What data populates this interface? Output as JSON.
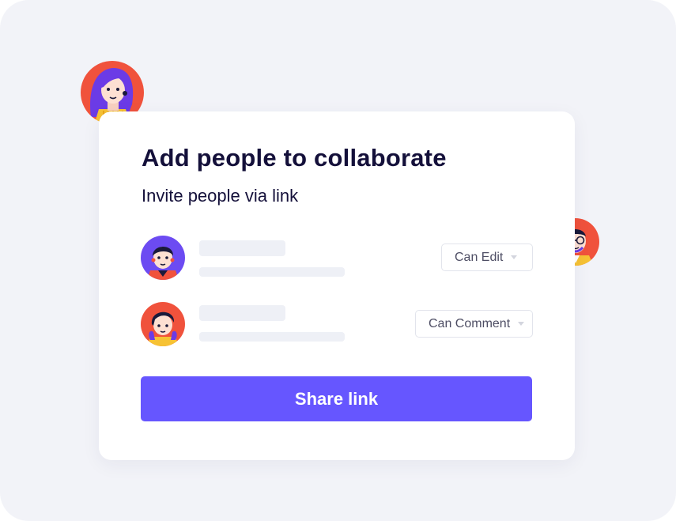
{
  "dialog": {
    "title": "Add people to collaborate",
    "subtitle": "Invite people via link",
    "collaborators": [
      {
        "avatar": "man-avatar-purple-bg",
        "permission": "Can Edit"
      },
      {
        "avatar": "boy-avatar-red-bg",
        "permission": "Can Comment"
      }
    ],
    "share_button_label": "Share link"
  },
  "floating_avatars": [
    {
      "avatar": "woman-avatar-purple-hair"
    },
    {
      "avatar": "man-avatar-glasses-beard"
    }
  ],
  "colors": {
    "background": "#f2f3f8",
    "card": "#ffffff",
    "heading": "#14103a",
    "accent": "#6656ff",
    "avatar_red": "#f0523c",
    "avatar_purple": "#6c4bf2",
    "skeleton": "#eef0f6"
  }
}
